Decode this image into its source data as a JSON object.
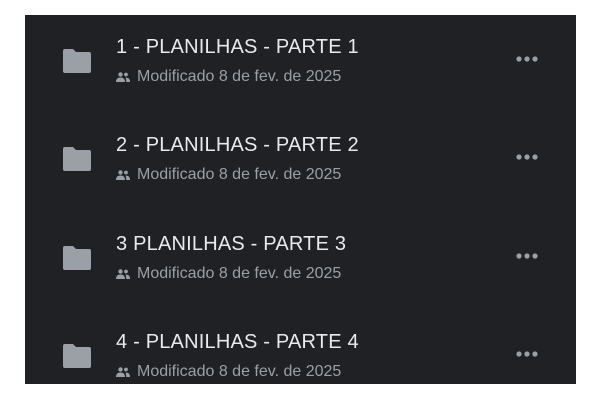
{
  "colors": {
    "panel_bg": "#202124",
    "title": "#e8eaed",
    "subtitle": "#9aa0a6",
    "icon": "#9aa0a6"
  },
  "items": [
    {
      "title": "1 - PLANILHAS - PARTE 1",
      "modified": "Modificado 8 de fev. de 2025",
      "icon": "folder-icon",
      "shared_icon": "people-icon",
      "menu_icon": "more-horizontal-icon"
    },
    {
      "title": "2 - PLANILHAS - PARTE 2",
      "modified": "Modificado 8 de fev. de 2025",
      "icon": "folder-icon",
      "shared_icon": "people-icon",
      "menu_icon": "more-horizontal-icon"
    },
    {
      "title": "3 PLANILHAS - PARTE 3",
      "modified": "Modificado 8 de fev. de 2025",
      "icon": "folder-icon",
      "shared_icon": "people-icon",
      "menu_icon": "more-horizontal-icon"
    },
    {
      "title": "4 - PLANILHAS - PARTE 4",
      "modified": "Modificado 8 de fev. de 2025",
      "icon": "folder-icon",
      "shared_icon": "people-icon",
      "menu_icon": "more-horizontal-icon"
    }
  ]
}
